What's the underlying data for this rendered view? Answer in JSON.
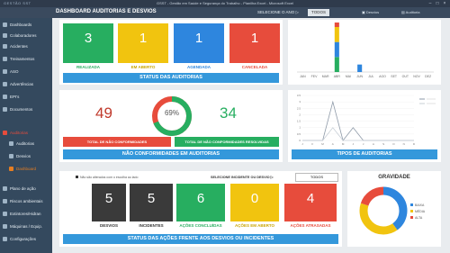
{
  "window": {
    "title": "GSST - Gestão em Saúde e Segurança do Trabalho - Planilha Excel - Microsoft Excel"
  },
  "header": {
    "logo": "GESTÃO SST",
    "title": "DASHBOARD AUDITORIAS E DESVIOS",
    "year_label": "SELECIONE O ANO ▷",
    "year_value": "TODOS",
    "icon1_label": "Desvios",
    "icon2_label": "Auditoria"
  },
  "sidebar": {
    "items": [
      {
        "label": "Dashboards"
      },
      {
        "label": "Colaboradores"
      },
      {
        "label": "Acidentes"
      },
      {
        "label": "Treinamentos"
      },
      {
        "label": "ASO"
      },
      {
        "label": "Advertências"
      },
      {
        "label": "EPI's"
      },
      {
        "label": "Documentos"
      },
      {
        "label": "Auditorias"
      },
      {
        "label": "Auditorias"
      },
      {
        "label": "Desvios"
      },
      {
        "label": "Dashboard"
      },
      {
        "label": "Plano de ação"
      },
      {
        "label": "Riscos ambientais"
      },
      {
        "label": "Extintores/Hidran"
      },
      {
        "label": "Máquinas / Equip."
      },
      {
        "label": "Configurações"
      }
    ]
  },
  "audits": {
    "kpis": [
      {
        "value": "3",
        "label": "REALIZADA",
        "color": "#27ae60"
      },
      {
        "value": "1",
        "label": "EM ABERTO",
        "color": "#f1c40f"
      },
      {
        "value": "1",
        "label": "AGENDADA",
        "color": "#2e86de"
      },
      {
        "value": "1",
        "label": "CANCELADA",
        "color": "#e74c3c"
      }
    ],
    "status_title": "STATUS DAS AUDITORIAS"
  },
  "nc": {
    "total": "49",
    "percent": "69%",
    "resolved": "34",
    "total_label": "TOTAL DE NÃO CONFORMIDADES",
    "resolved_label": "TOTAL DE NÃO CONFORMIDADES RESOLVIDAS",
    "title": "NÃO CONFORMIDADES EM AUDITORIAS",
    "ring_fraction": 0.69
  },
  "types_title": "TIPOS DE AUDITORIAS",
  "actions": {
    "checkbox_label": "Não são alterados com o escolha ao lado",
    "select_label": "SELECIONE INCIDENTE OU DESVIO ▷",
    "select_value": "TODOS",
    "kpis": [
      {
        "value": "5",
        "label": "DESVIOS",
        "color": "#3a3a3a"
      },
      {
        "value": "5",
        "label": "INCIDENTES",
        "color": "#3a3a3a"
      },
      {
        "value": "6",
        "label": "AÇÕES CONCLUÍDAS",
        "color": "#27ae60"
      },
      {
        "value": "0",
        "label": "AÇÕES EM ABERTO",
        "color": "#f1c40f"
      },
      {
        "value": "4",
        "label": "AÇÕES ATRASADAS",
        "color": "#e74c3c"
      }
    ],
    "title": "STATUS DAS AÇÕES FRENTE AOS DESVIOS OU INCIDENTES"
  },
  "gravity": {
    "title": "GRAVIDADE",
    "legend": [
      "BAIXA",
      "MÉDIA",
      "ALTA"
    ],
    "colors": [
      "#2e86de",
      "#f1c40f",
      "#e74c3c"
    ]
  },
  "chart_data": [
    {
      "type": "bar",
      "categories": [
        "JAN",
        "FEV",
        "MAR",
        "ABR",
        "MAI",
        "JUN",
        "JUL",
        "AGO",
        "SET",
        "OUT",
        "NOV",
        "DEZ"
      ],
      "series": [
        {
          "values": [
            0,
            0,
            0,
            1,
            0,
            0,
            0,
            0,
            0,
            0,
            0,
            0
          ],
          "color": "#27ae60"
        },
        {
          "values": [
            0,
            0,
            0,
            1,
            0,
            0.5,
            0,
            0,
            0,
            0,
            0,
            0
          ],
          "color": "#2e86de"
        },
        {
          "values": [
            0,
            0,
            0,
            1,
            0,
            0,
            0,
            0,
            0,
            0,
            0,
            0
          ],
          "color": "#f1c40f"
        },
        {
          "values": [
            0,
            0,
            0,
            0.3,
            0,
            0,
            0,
            0,
            0,
            0,
            0,
            0
          ],
          "color": "#e74c3c"
        }
      ],
      "stacked": true
    },
    {
      "type": "line",
      "categories": [
        "J",
        "F",
        "M",
        "A",
        "M",
        "J",
        "J",
        "A",
        "S",
        "O",
        "N",
        "D"
      ],
      "ylim": [
        0,
        3.5
      ],
      "yticks": [
        "0",
        "0.5",
        "1",
        "1.5",
        "2",
        "2.5",
        "3",
        "3.5"
      ],
      "series": [
        {
          "values": [
            0,
            0,
            0,
            3,
            0,
            1,
            0,
            0,
            0,
            0,
            0,
            0
          ],
          "color": "#8e9aa8"
        },
        {
          "values": [
            0,
            0,
            0,
            1,
            0,
            0,
            0,
            0,
            0,
            0,
            0,
            0
          ],
          "color": "#c8cfd6"
        }
      ]
    },
    {
      "type": "pie",
      "labels": [
        "BAIXA",
        "MÉDIA",
        "ALTA"
      ],
      "values": [
        4,
        4,
        2
      ]
    }
  ]
}
